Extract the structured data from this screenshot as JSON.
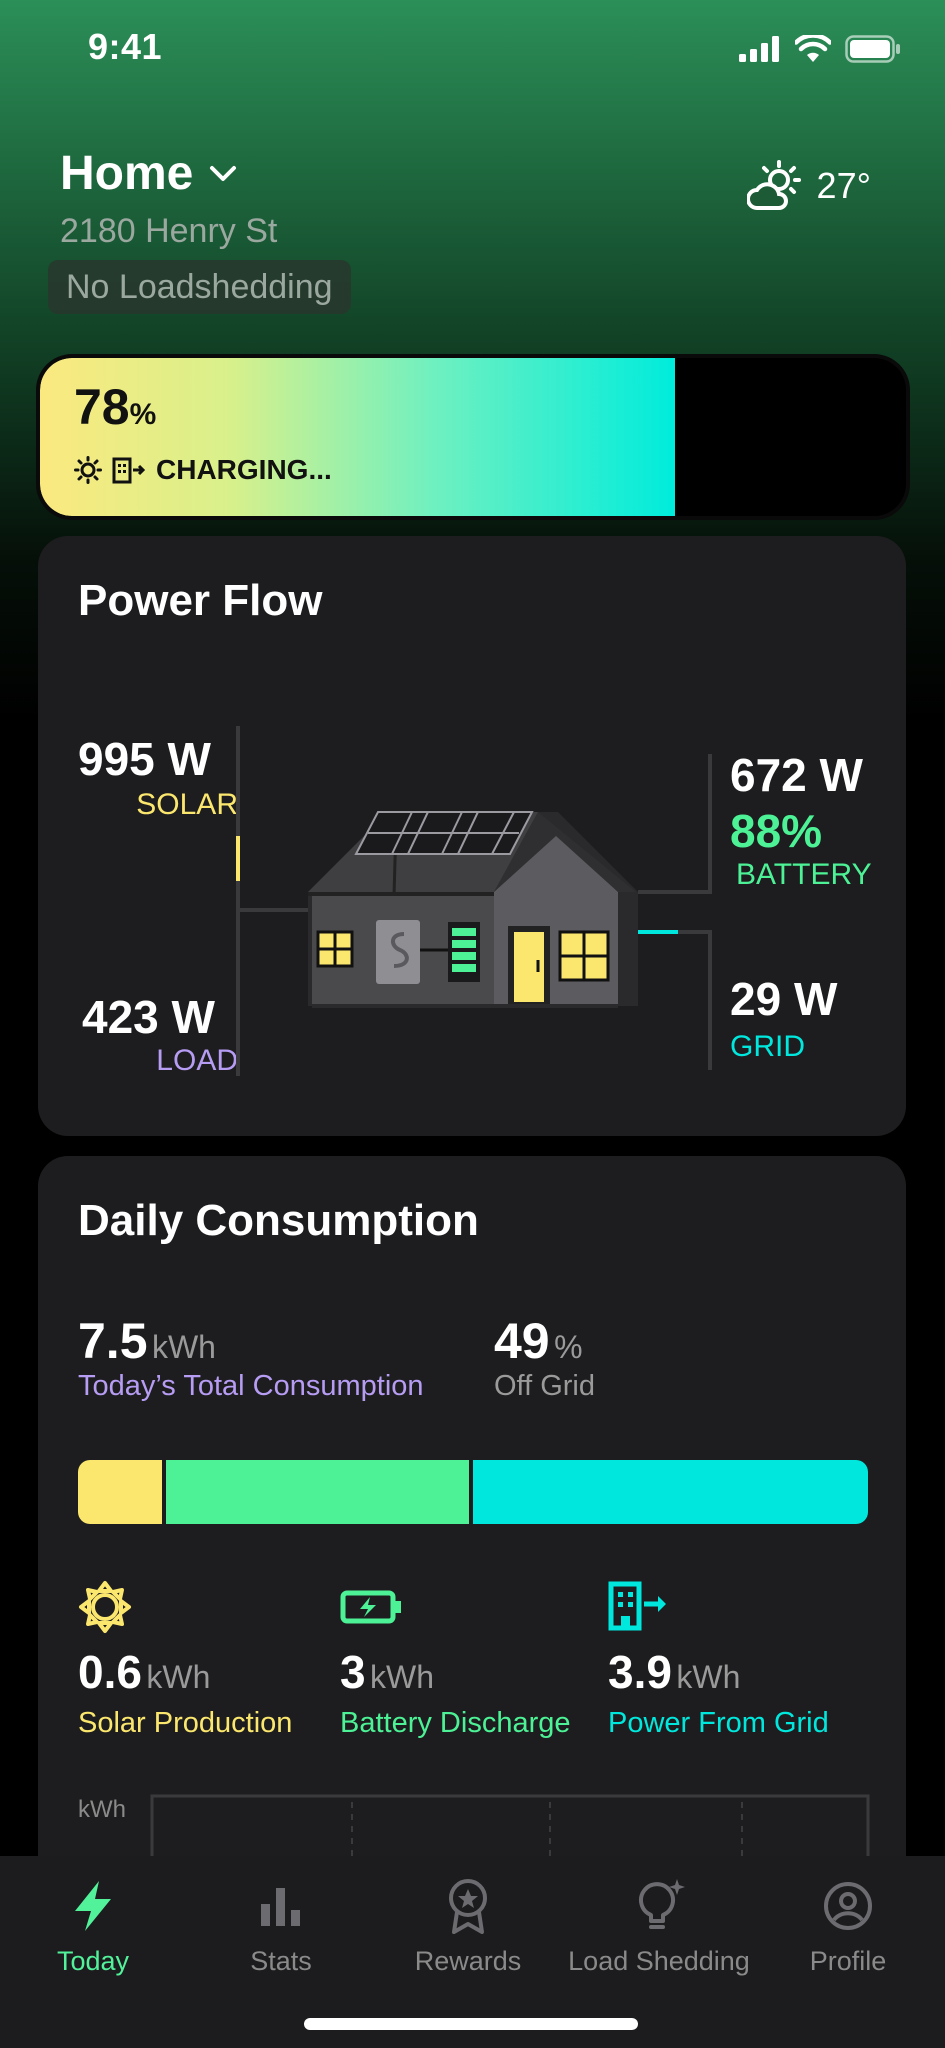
{
  "status_bar": {
    "time": "9:41"
  },
  "header": {
    "location": "Home",
    "address": "2180 Henry St",
    "loadshedding": "No Loadshedding",
    "temperature": "27°"
  },
  "battery": {
    "percent": "78",
    "percent_unit": "%",
    "charge_fraction": 0.78,
    "status": "CHARGING..."
  },
  "power_flow": {
    "title": "Power Flow",
    "solar": {
      "value": "995 W",
      "label": "SOLAR"
    },
    "load": {
      "value": "423 W",
      "label": "LOAD"
    },
    "battery": {
      "value": "672 W",
      "percent": "88%",
      "label": "BATTERY"
    },
    "grid": {
      "value": "29 W",
      "label": "GRID"
    }
  },
  "daily_consumption": {
    "title": "Daily Consumption",
    "total": {
      "value": "7.5",
      "unit": "kWh",
      "label": "Today’s Total Consumption"
    },
    "off_grid": {
      "value": "49",
      "unit": "%",
      "label": "Off Grid"
    },
    "breakdown": [
      {
        "name": "Solar Production",
        "value": "0.6",
        "unit": "kWh",
        "color": "#fbe66e"
      },
      {
        "name": "Battery Discharge",
        "value": "3",
        "unit": "kWh",
        "color": "#4cf295"
      },
      {
        "name": "Power From Grid",
        "value": "3.9",
        "unit": "kWh",
        "color": "#00e8dd"
      }
    ],
    "chart_axis_label": "kWh"
  },
  "colors": {
    "solar": "#fbe66e",
    "battery": "#4cf295",
    "grid": "#00e8dd",
    "load": "#b69cf3",
    "active_tab": "#52f29b"
  },
  "tabs": [
    {
      "label": "Today",
      "icon": "bolt-icon",
      "active": true
    },
    {
      "label": "Stats",
      "icon": "bar-chart-icon",
      "active": false
    },
    {
      "label": "Rewards",
      "icon": "medal-icon",
      "active": false
    },
    {
      "label": "Load Shedding",
      "icon": "lightbulb-icon",
      "active": false
    },
    {
      "label": "Profile",
      "icon": "profile-icon",
      "active": false
    }
  ]
}
